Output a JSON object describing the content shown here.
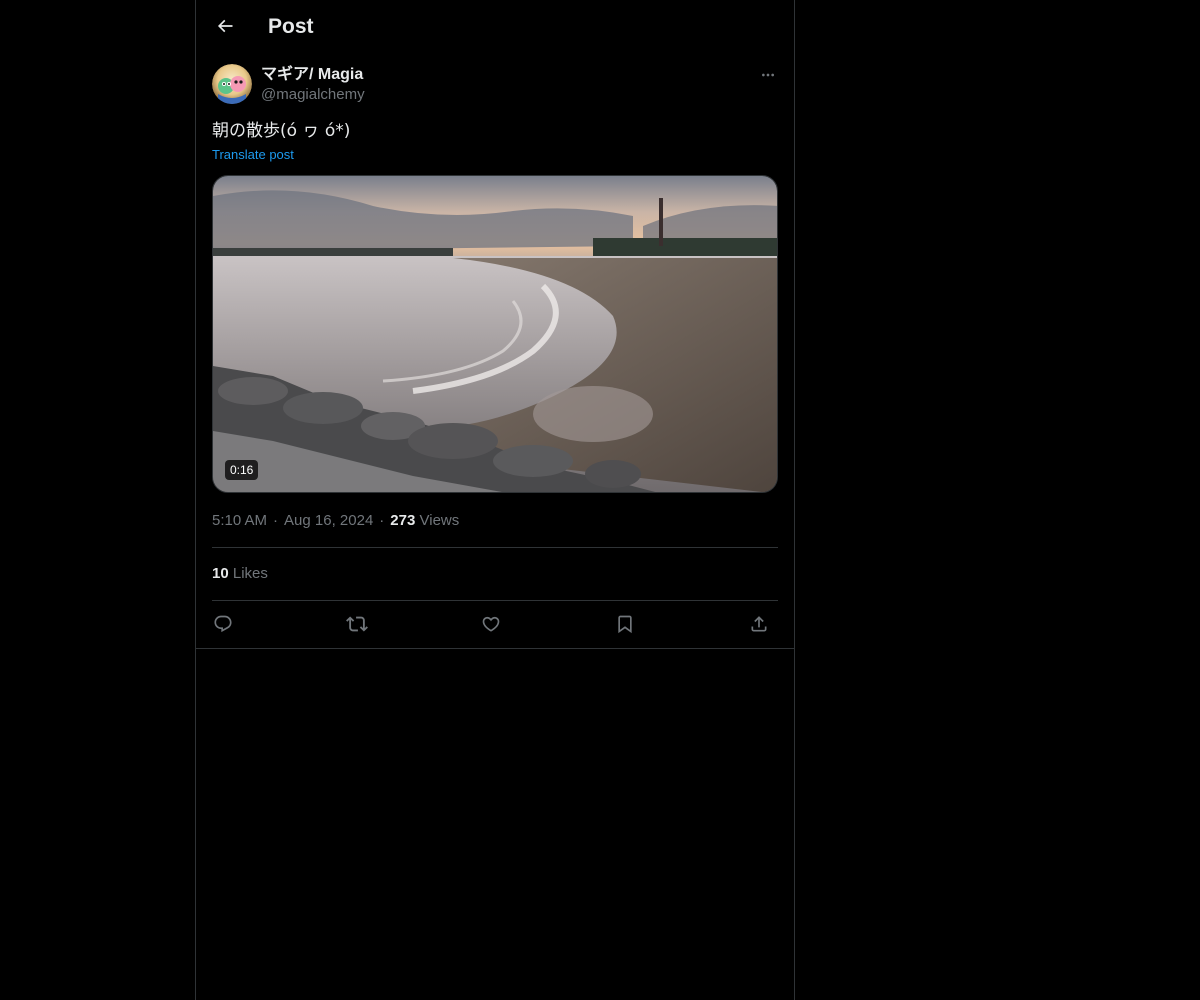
{
  "header": {
    "title": "Post",
    "back_icon": "arrow-left-icon"
  },
  "post": {
    "author": {
      "display_name": "マギア/ Magia",
      "handle": "@magialchemy",
      "avatar_icon": "avatar-image"
    },
    "more_icon": "more-horizontal-icon",
    "text": "朝の散歩(ó ヮ ó*)",
    "translate_label": "Translate post",
    "media": {
      "type": "video",
      "duration": "0:16"
    },
    "meta": {
      "time": "5:10 AM",
      "separator": "·",
      "date": "Aug 16, 2024",
      "views_count": "273",
      "views_label": "Views"
    },
    "likes": {
      "count": "10",
      "label": "Likes"
    },
    "actions": [
      {
        "name": "reply",
        "icon": "reply-icon"
      },
      {
        "name": "repost",
        "icon": "repost-icon"
      },
      {
        "name": "like",
        "icon": "heart-icon"
      },
      {
        "name": "bookmark",
        "icon": "bookmark-icon"
      },
      {
        "name": "share",
        "icon": "share-icon"
      }
    ]
  },
  "colors": {
    "background": "#000000",
    "text_primary": "#e7e9ea",
    "text_secondary": "#71767b",
    "link": "#1d9bf0",
    "border": "#2f3336"
  }
}
